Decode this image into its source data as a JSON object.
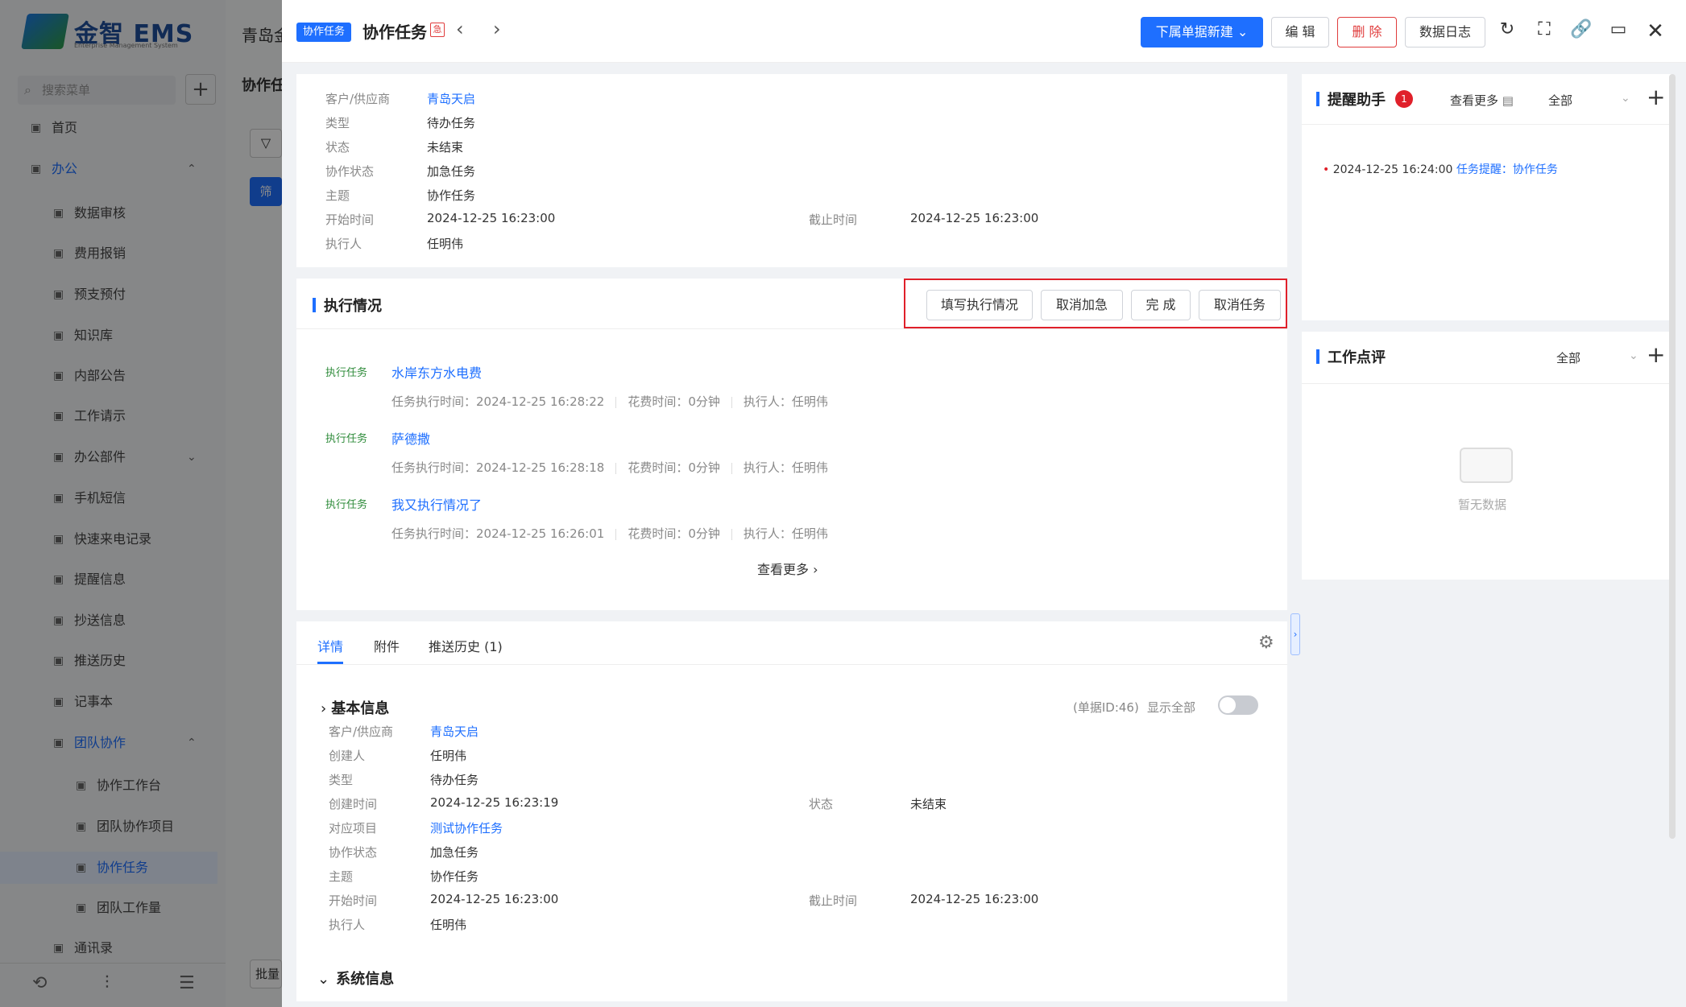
{
  "background_app": {
    "logo_text": "金智 EMS",
    "logo_sub": "Enterprise Management System",
    "company_partial": "青岛金",
    "search_placeholder": "搜索菜单",
    "main_title_partial": "协作任",
    "filter_button_partial": "筛",
    "bulk_button_partial": "批量",
    "nav": [
      {
        "label": "首页",
        "icon": "grid-icon"
      },
      {
        "label": "办公",
        "icon": "office-icon",
        "expanded": true
      },
      {
        "label": "数据审核",
        "icon": "user-icon"
      },
      {
        "label": "费用报销",
        "icon": "receipt-icon"
      },
      {
        "label": "预支预付",
        "icon": "wallet-icon"
      },
      {
        "label": "知识库",
        "icon": "book-icon"
      },
      {
        "label": "内部公告",
        "icon": "speaker-icon"
      },
      {
        "label": "工作请示",
        "icon": "request-icon"
      },
      {
        "label": "办公部件",
        "icon": "parts-icon",
        "expandable": true
      },
      {
        "label": "手机短信",
        "icon": "sms-icon"
      },
      {
        "label": "快速来电记录",
        "icon": "phone-log-icon"
      },
      {
        "label": "提醒信息",
        "icon": "bell-icon"
      },
      {
        "label": "抄送信息",
        "icon": "send-icon"
      },
      {
        "label": "推送历史",
        "icon": "clock-icon"
      },
      {
        "label": "记事本",
        "icon": "notebook-icon"
      },
      {
        "label": "团队协作",
        "icon": "team-icon",
        "expanded": true
      },
      {
        "label": "协作工作台",
        "icon": "grid-icon"
      },
      {
        "label": "团队协作项目",
        "icon": "group-icon"
      },
      {
        "label": "协作任务",
        "icon": "task-icon",
        "active": true
      },
      {
        "label": "团队工作量",
        "icon": "group-icon"
      },
      {
        "label": "通讯录",
        "icon": "contacts-icon"
      }
    ]
  },
  "drawer": {
    "tag": "协作任务",
    "title": "协作任务",
    "buttons": {
      "new_sub": "下属单据新建",
      "edit": "编 辑",
      "delete": "删 除",
      "log": "数据日志"
    },
    "summary": [
      {
        "key": "客户/供应商",
        "value": "青岛天启",
        "link": true
      },
      {
        "key": "类型",
        "value": "待办任务"
      },
      {
        "key": "状态",
        "value": "未结束"
      },
      {
        "key": "协作状态",
        "value": "加急任务"
      },
      {
        "key": "主题",
        "value": "协作任务"
      },
      {
        "key": "开始时间",
        "value": "2024-12-25 16:23:00"
      },
      {
        "key": "执行人",
        "value": "任明伟"
      }
    ],
    "summary_deadline": {
      "key": "截止时间",
      "value": "2024-12-25 16:23:00"
    },
    "execution": {
      "title": "执行情况",
      "actions": [
        "填写执行情况",
        "取消加急",
        "完 成",
        "取消任务"
      ],
      "items": [
        {
          "tag": "执行任务",
          "title": "水岸东方水电费",
          "time": "任务执行时间：2024-12-25 16:28:22",
          "cost": "花费时间：0分钟",
          "executor": "执行人：任明伟"
        },
        {
          "tag": "执行任务",
          "title": "萨德撒",
          "time": "任务执行时间：2024-12-25 16:28:18",
          "cost": "花费时间：0分钟",
          "executor": "执行人：任明伟"
        },
        {
          "tag": "执行任务",
          "title": "我又执行情况了",
          "time": "任务执行时间：2024-12-25 16:26:01",
          "cost": "花费时间：0分钟",
          "executor": "执行人：任明伟"
        }
      ],
      "more": "查看更多"
    },
    "tabs": [
      "详情",
      "附件",
      "推送历史 (1)"
    ],
    "basic_info": {
      "title": "基本信息",
      "doc_id": "(单据ID:46)",
      "show_all": "显示全部",
      "show_all_on": false,
      "left": [
        {
          "key": "客户/供应商",
          "value": "青岛天启",
          "link": true
        },
        {
          "key": "创建人",
          "value": "任明伟"
        },
        {
          "key": "类型",
          "value": "待办任务"
        },
        {
          "key": "创建时间",
          "value": "2024-12-25 16:23:19"
        },
        {
          "key": "对应项目",
          "value": "测试协作任务",
          "link": true
        },
        {
          "key": "协作状态",
          "value": "加急任务"
        },
        {
          "key": "主题",
          "value": "协作任务"
        },
        {
          "key": "开始时间",
          "value": "2024-12-25 16:23:00"
        },
        {
          "key": "执行人",
          "value": "任明伟"
        }
      ],
      "status": {
        "key": "状态",
        "value": "未结束"
      },
      "deadline": {
        "key": "截止时间",
        "value": "2024-12-25 16:23:00"
      }
    },
    "system_info_title": "系统信息",
    "reminder": {
      "title": "提醒助手",
      "badge": "1",
      "more": "查看更多",
      "filter": "全部",
      "item_time": "2024-12-25 16:24:00",
      "item_text": "任务提醒：协作任务"
    },
    "review": {
      "title": "工作点评",
      "filter": "全部",
      "empty": "暂无数据"
    }
  }
}
